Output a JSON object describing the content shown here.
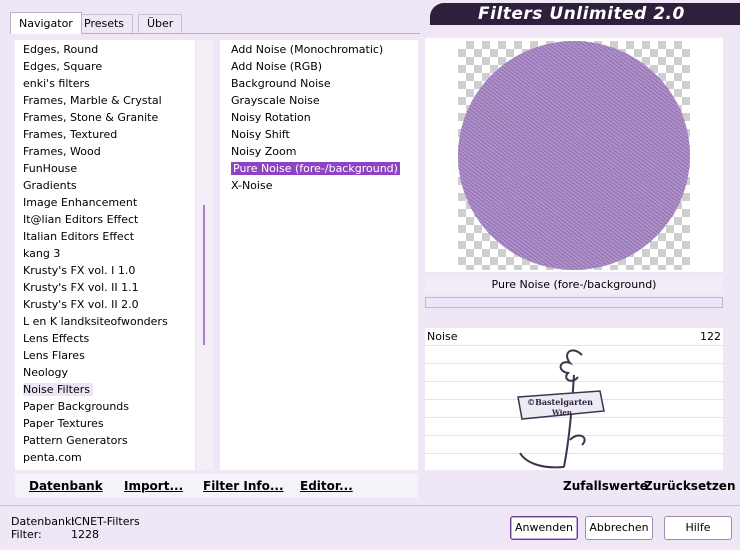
{
  "tabs": [
    {
      "label": "Navigator"
    },
    {
      "label": "Presets"
    },
    {
      "label": "Über"
    }
  ],
  "banner_title": "Filters Unlimited 2.0",
  "categories": [
    "Edges, Round",
    "Edges, Square",
    "enki's filters",
    "Frames, Marble & Crystal",
    "Frames, Stone & Granite",
    "Frames, Textured",
    "Frames, Wood",
    "FunHouse",
    "Gradients",
    "Image Enhancement",
    "It@lian Editors Effect",
    "Italian Editors Effect",
    "kang 3",
    "Krusty's FX vol. I 1.0",
    "Krusty's FX vol. II 1.1",
    "Krusty's FX vol. II 2.0",
    "L en K landksiteofwonders",
    "Lens Effects",
    "Lens Flares",
    "Neology",
    "Noise Filters",
    "Paper Backgrounds",
    "Paper Textures",
    "Pattern Generators",
    "penta.com"
  ],
  "selected_category": "Noise Filters",
  "filters": [
    "Add Noise (Monochromatic)",
    "Add Noise (RGB)",
    "Background Noise",
    "Grayscale Noise",
    "Noisy Rotation",
    "Noisy Shift",
    "Noisy Zoom",
    "Pure Noise (fore-/background)",
    "X-Noise"
  ],
  "selected_filter": "Pure Noise (fore-/background)",
  "preview_label": "Pure Noise (fore-/background)",
  "params": [
    {
      "name": "Noise",
      "value": "122"
    }
  ],
  "watermark_text": [
    "©Bastelgarten",
    "Wien"
  ],
  "bottom_links": {
    "database": "Datenbank",
    "import": "Import...",
    "filter_info": "Filter Info...",
    "editor": "Editor...",
    "randomize": "Zufallswerte",
    "reset": "Zurücksetzen"
  },
  "footer": {
    "db_label": "Datenbank:",
    "db_value": "ICNET-Filters",
    "filter_label": "Filter:",
    "filter_value": "1228"
  },
  "buttons": {
    "apply": "Anwenden",
    "cancel": "Abbrechen",
    "help": "Hilfe"
  },
  "colors": {
    "selection": "#8e44c2",
    "banner": "#2e1f3d",
    "noise_preview": "#a582c4"
  }
}
